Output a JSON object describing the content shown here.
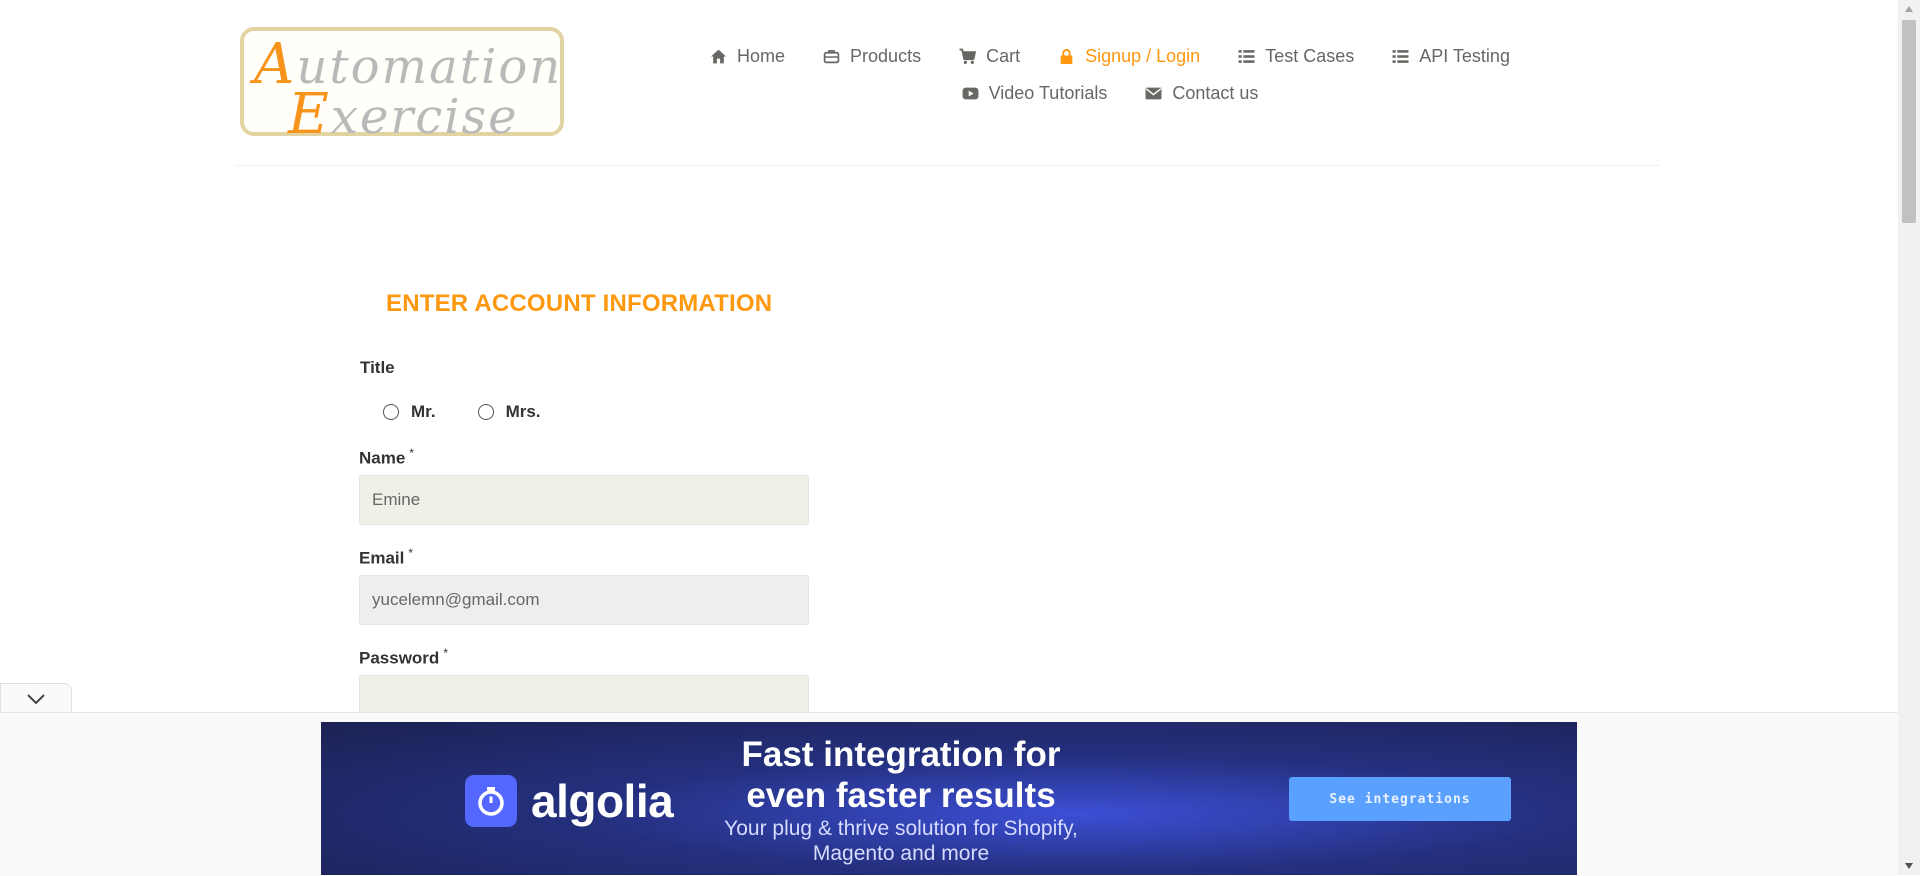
{
  "header": {
    "nav_row1": [
      {
        "label": "Home",
        "icon": "home-icon"
      },
      {
        "label": "Products",
        "icon": "briefcase-icon"
      },
      {
        "label": "Cart",
        "icon": "cart-icon"
      },
      {
        "label": "Signup / Login",
        "icon": "lock-icon",
        "active": true
      },
      {
        "label": "Test Cases",
        "icon": "list-icon"
      },
      {
        "label": "API Testing",
        "icon": "list-icon"
      }
    ],
    "nav_row2": [
      {
        "label": "Video Tutorials",
        "icon": "youtube-play-icon"
      },
      {
        "label": "Contact us",
        "icon": "envelope-icon"
      }
    ]
  },
  "form": {
    "heading": "ENTER ACCOUNT INFORMATION",
    "title_label": "Title",
    "title_options": [
      "Mr.",
      "Mrs."
    ],
    "name_label": "Name",
    "name_value": "Emine",
    "email_label": "Email",
    "email_value": "yucelemn@gmail.com",
    "password_label": "Password",
    "password_value": "",
    "required_mark": "*"
  },
  "ad": {
    "brand": "algolia",
    "headline": "Fast integration for even faster results",
    "subline": "Your plug & thrive solution for Shopify, Magento and more",
    "cta": "See integrations"
  },
  "colors": {
    "accent": "#fe980f",
    "text": "#696763",
    "input_bg": "#f0f0e9"
  }
}
